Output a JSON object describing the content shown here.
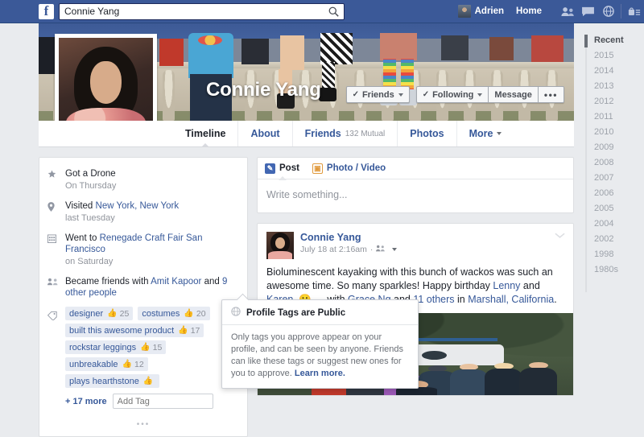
{
  "topnav": {
    "logo": "f",
    "logo_icon": "facebook-logo",
    "search": {
      "value": "Connie Yang",
      "placeholder": "Search",
      "icon": "search-icon"
    },
    "account_name": "Adrien",
    "home_label": "Home",
    "icons": [
      "friend-requests-icon",
      "messages-icon",
      "notifications-globe-icon",
      "privacy-lock-icon"
    ]
  },
  "profile": {
    "name": "Connie Yang",
    "profile_photo_alt": "profile-photo",
    "cover_photo_alt": "cover-photo",
    "actions": {
      "friends": "Friends",
      "following": "Following",
      "message": "Message",
      "more": "•••",
      "check": "✓"
    }
  },
  "tabs": [
    {
      "label": "Timeline",
      "sub": "",
      "active": true
    },
    {
      "label": "About",
      "sub": "",
      "active": false
    },
    {
      "label": "Friends",
      "sub": "132 Mutual",
      "active": false
    },
    {
      "label": "Photos",
      "sub": "",
      "active": false
    },
    {
      "label": "More",
      "sub": "",
      "active": false,
      "caret": true
    }
  ],
  "life_events": [
    {
      "icon": "star-icon",
      "text_pre": "Got a Drone",
      "link": "",
      "text_post": "",
      "sub": "On Thursday"
    },
    {
      "icon": "location-pin-icon",
      "text_pre": "Visited ",
      "link": "New York, New York",
      "text_post": "",
      "sub": "last Tuesday"
    },
    {
      "icon": "calendar-icon",
      "text_pre": "Went to ",
      "link": "Renegade Craft Fair San Francisco",
      "text_post": "",
      "sub": "on Saturday"
    },
    {
      "icon": "friends-icon",
      "text_pre": "Became friends with ",
      "link": "Amit Kapoor",
      "text_post": " and ",
      "link2": "9 other people",
      "sub": ""
    }
  ],
  "tags": {
    "icon": "tag-icon",
    "globe_badge": "globe-icon",
    "chips": [
      {
        "label": "designer",
        "count": "25"
      },
      {
        "label": "costumes",
        "count": "20"
      },
      {
        "label": "built this awesome product",
        "count": "17"
      },
      {
        "label": "rockstar leggings",
        "count": "15"
      },
      {
        "label": "unbreakable",
        "count": "12"
      },
      {
        "label": "plays hearthstone",
        "count": ""
      }
    ],
    "more_label": "+ 17 more",
    "add_tag_placeholder": "Add Tag",
    "ellipsis": "•••"
  },
  "tooltip": {
    "icon": "globe-icon",
    "title": "Profile Tags are Public",
    "body": "Only tags you approve appear on your profile, and can be seen by anyone. Friends can like these tags or suggest new ones for you to approve.",
    "link": "Learn more."
  },
  "composer": {
    "tabs": [
      {
        "label": "Post",
        "icon": "pencil-icon",
        "active": true
      },
      {
        "label": "Photo / Video",
        "icon": "photo-icon",
        "active": false
      }
    ],
    "placeholder": "Write something..."
  },
  "post": {
    "author": "Connie Yang",
    "timestamp": "July 18 at 2:16am",
    "audience_icon": "friends-audience-icon",
    "options_icon": "chevron-down-icon",
    "avatar_alt": "post-author-avatar",
    "text": [
      {
        "t": "Bioluminescent kayaking with this bunch of wackos was such an awesome time. So many sparkles! Happy birthday ",
        "link": false
      },
      {
        "t": "Lenny",
        "link": true
      },
      {
        "t": " and ",
        "link": false
      },
      {
        "t": "Karen",
        "link": true
      },
      {
        "t": ". 😀 — with ",
        "link": false
      },
      {
        "t": "Grace Ng",
        "link": true
      },
      {
        "t": " and ",
        "link": false
      },
      {
        "t": "11 others",
        "link": true
      },
      {
        "t": " in ",
        "link": false
      },
      {
        "t": "Marshall, California",
        "link": true
      },
      {
        "t": ".",
        "link": false
      }
    ],
    "photo_alt": "group-photo-with-kayaks"
  },
  "year_rail": {
    "items": [
      {
        "label": "Recent",
        "active": true
      },
      {
        "label": "2015",
        "active": false
      },
      {
        "label": "2014",
        "active": false
      },
      {
        "label": "2013",
        "active": false
      },
      {
        "label": "2012",
        "active": false
      },
      {
        "label": "2011",
        "active": false
      },
      {
        "label": "2010",
        "active": false
      },
      {
        "label": "2009",
        "active": false
      },
      {
        "label": "2008",
        "active": false
      },
      {
        "label": "2007",
        "active": false
      },
      {
        "label": "2006",
        "active": false
      },
      {
        "label": "2005",
        "active": false
      },
      {
        "label": "2004",
        "active": false
      },
      {
        "label": "2002",
        "active": false
      },
      {
        "label": "1998",
        "active": false
      },
      {
        "label": "1980s",
        "active": false
      }
    ]
  },
  "colors": {
    "brand_blue": "#3b5998",
    "link_blue": "#365899",
    "page_bg": "#e9ebee",
    "card_border": "#dddfe2",
    "chip_bg": "#e7ebf3",
    "muted_text": "#90949c"
  }
}
